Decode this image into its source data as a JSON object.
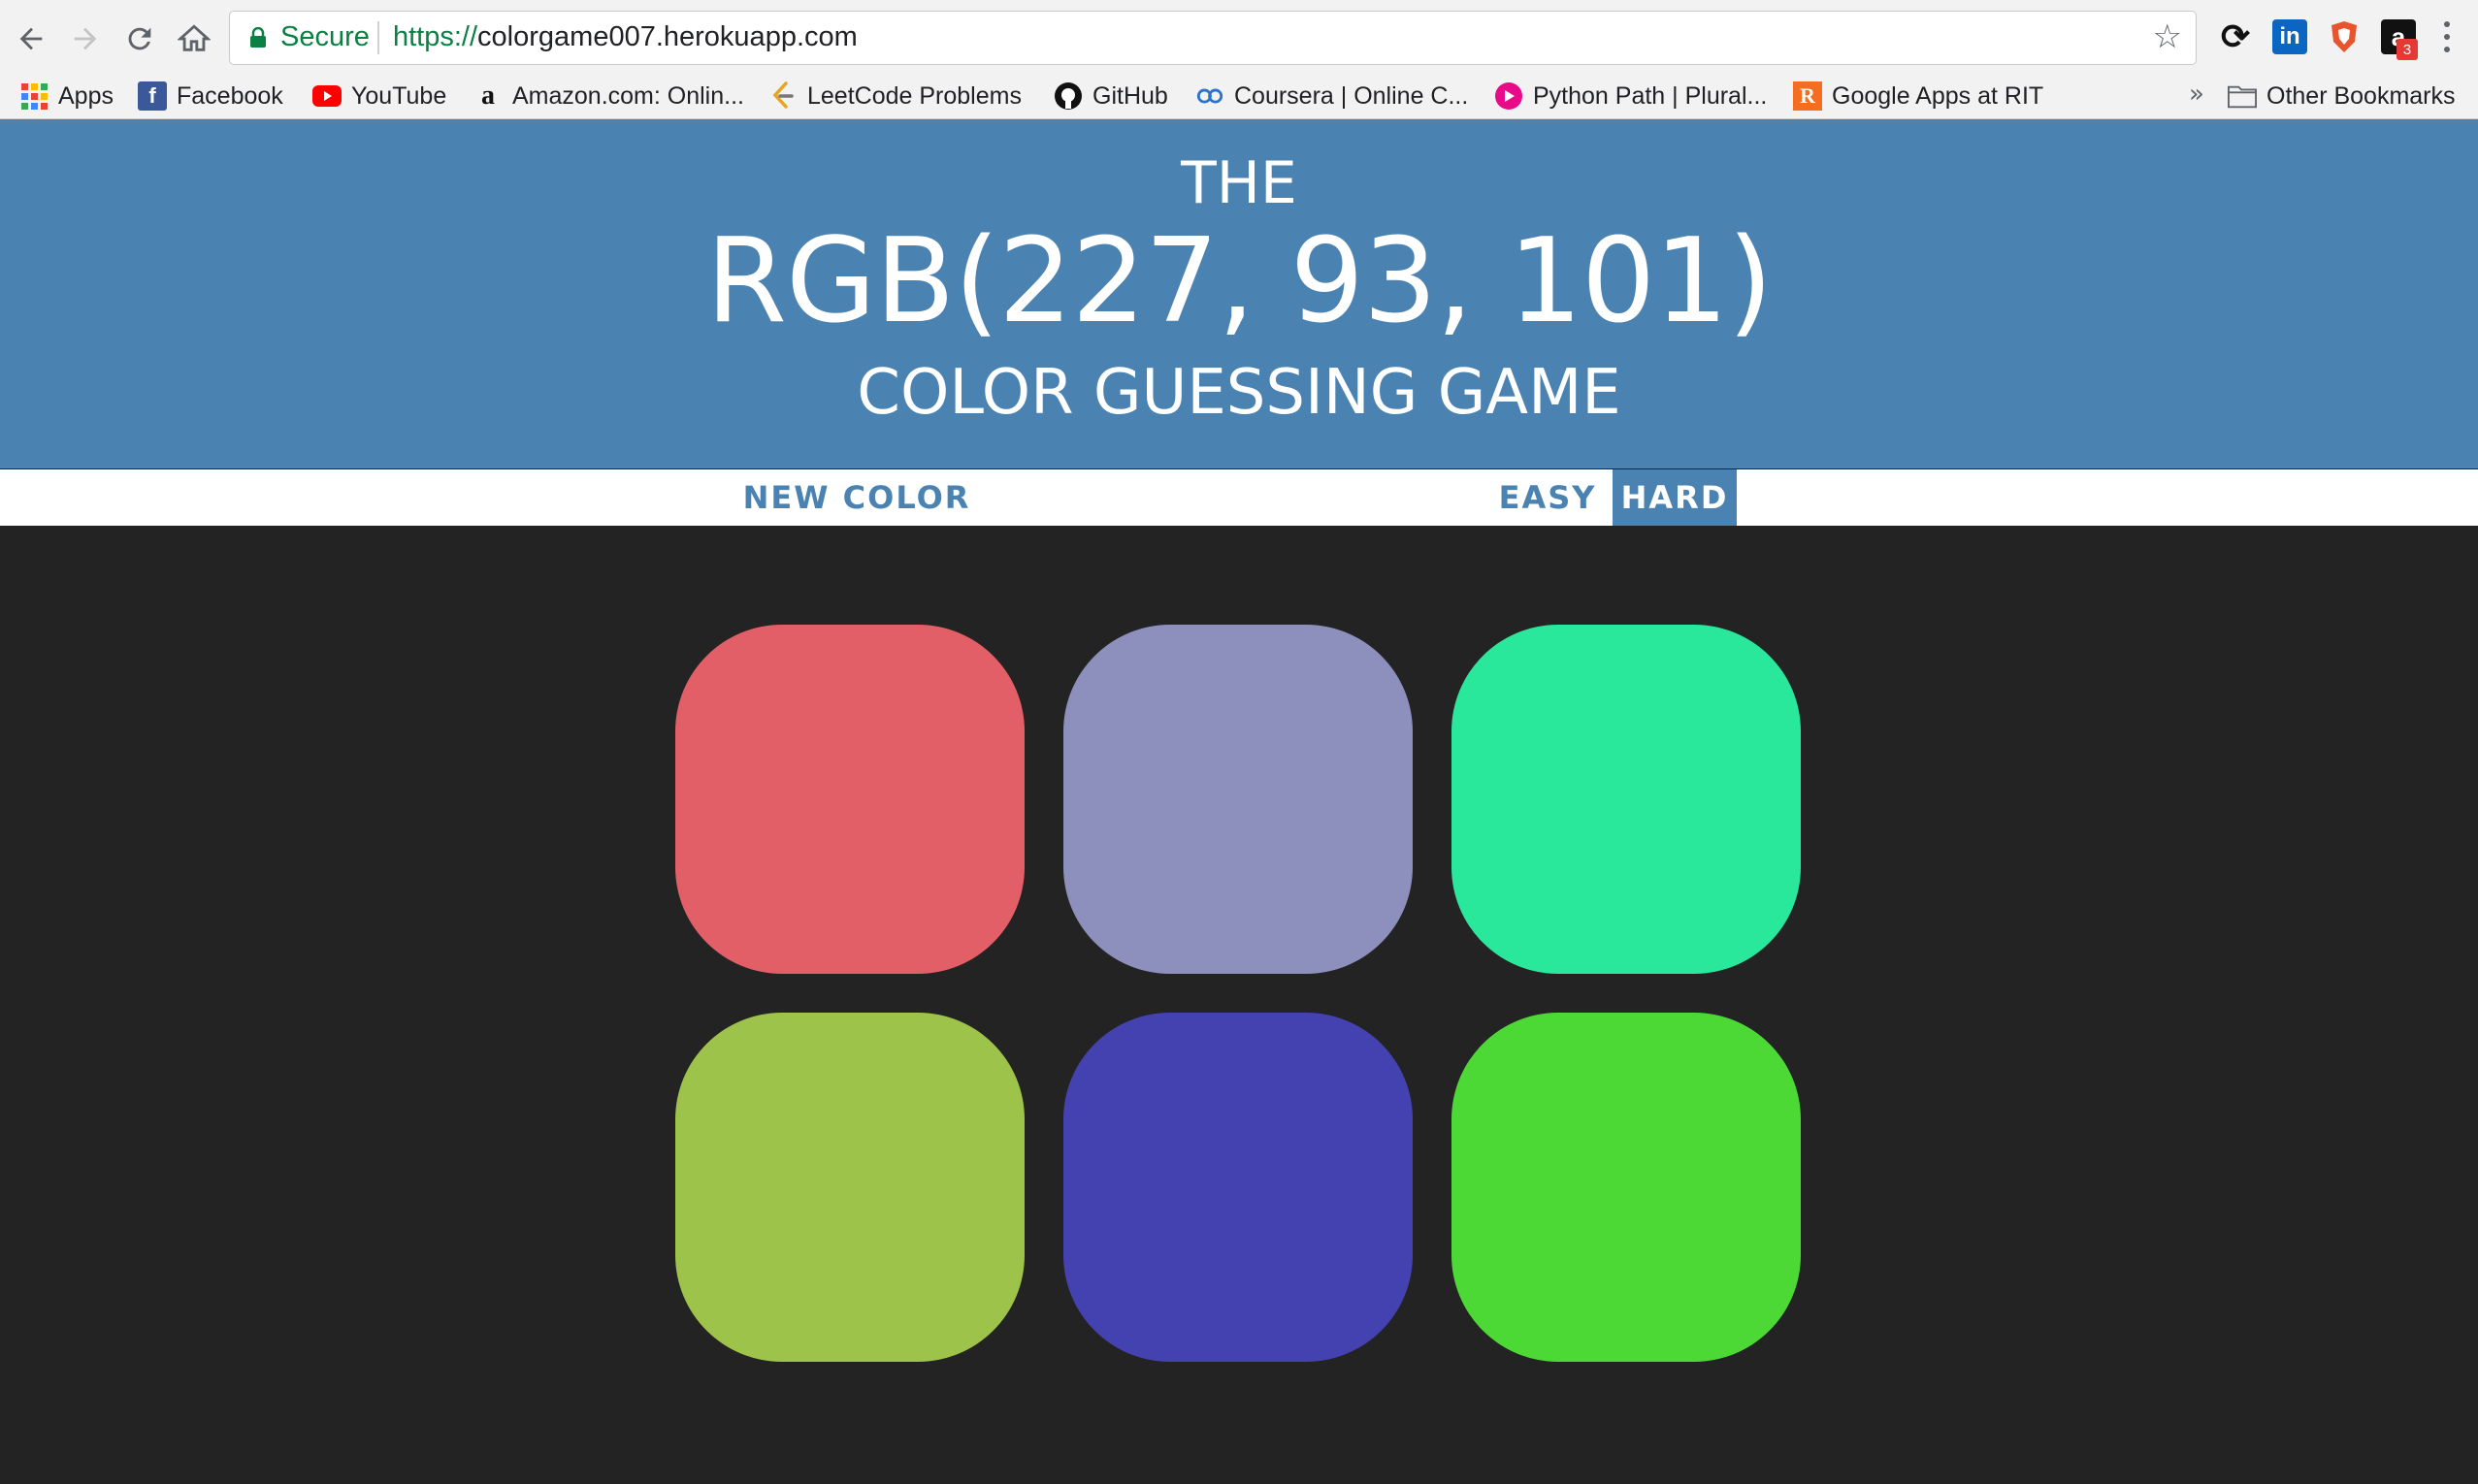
{
  "browser": {
    "nav": {
      "back_icon": "arrow-left-icon",
      "forward_icon": "arrow-right-icon",
      "reload_icon": "reload-icon",
      "home_icon": "home-icon"
    },
    "omnibox": {
      "secure_label": "Secure",
      "url_scheme": "https://",
      "url_rest": "colorgame007.herokuapp.com"
    },
    "extensions": [
      {
        "name": "sync",
        "label": "⟳"
      },
      {
        "name": "linkedin",
        "label": "in"
      },
      {
        "name": "brave",
        "label": ""
      },
      {
        "name": "amazon-assistant",
        "label": "a",
        "badge": "3"
      }
    ],
    "bookmarks": [
      {
        "label": "Apps",
        "icon": "apps-grid-icon"
      },
      {
        "label": "Facebook",
        "icon": "facebook-icon"
      },
      {
        "label": "YouTube",
        "icon": "youtube-icon"
      },
      {
        "label": "Amazon.com: Onlin...",
        "icon": "amazon-icon"
      },
      {
        "label": "LeetCode Problems",
        "icon": "leetcode-icon"
      },
      {
        "label": "GitHub",
        "icon": "github-icon"
      },
      {
        "label": "Coursera | Online C...",
        "icon": "coursera-icon"
      },
      {
        "label": "Python Path | Plural...",
        "icon": "pluralsight-icon"
      },
      {
        "label": "Google Apps at RIT",
        "icon": "rit-icon"
      }
    ],
    "overflow_label": "»",
    "other_bookmarks": "Other Bookmarks"
  },
  "header": {
    "line1": "THE",
    "rgb": "RGB(227, 93, 101)",
    "line3": "COLOR GUESSING GAME",
    "background": "#4a82b2"
  },
  "stripe": {
    "new_color": "NEW COLOR",
    "easy": "EASY",
    "hard": "HARD",
    "selected_mode": "HARD"
  },
  "squares": [
    {
      "color": "#e25f67"
    },
    {
      "color": "#8d8fbc"
    },
    {
      "color": "#29e89c"
    },
    {
      "color": "#9dc34a"
    },
    {
      "color": "#4442b0"
    },
    {
      "color": "#4dd935"
    }
  ]
}
